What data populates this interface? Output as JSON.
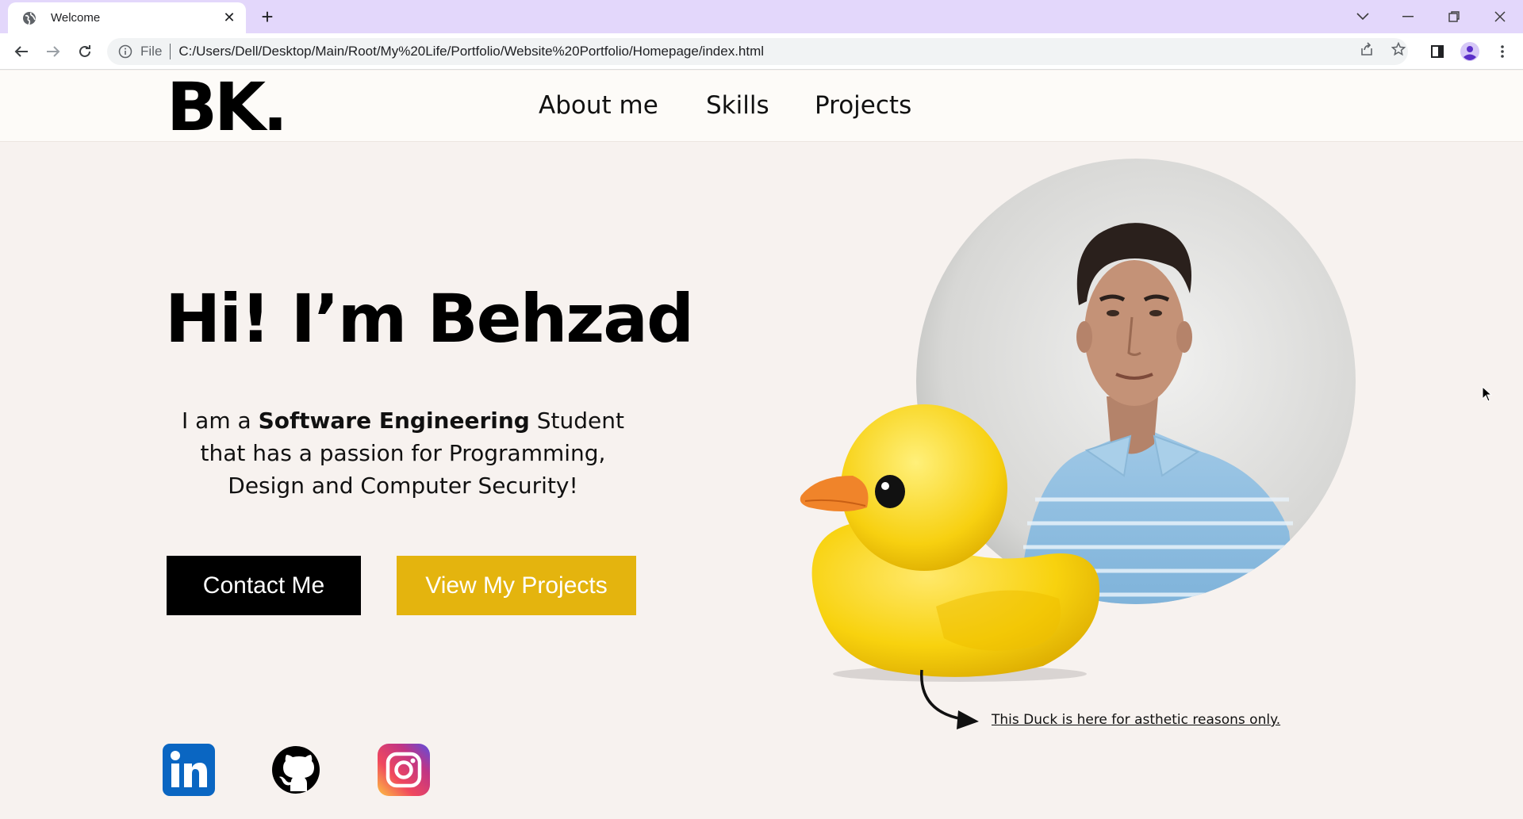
{
  "browser": {
    "tab_title": "Welcome",
    "omnibox_scheme": "File",
    "url": "C:/Users/Dell/Desktop/Main/Root/My%20Life/Portfolio/Website%20Portfolio/Homepage/index.html",
    "chrome_color": "#e3d7fb"
  },
  "site": {
    "logo": "BK.",
    "nav": [
      "About me",
      "Skills",
      "Projects"
    ]
  },
  "hero": {
    "title": "Hi! I’m Behzad",
    "intro_prefix": "I am a ",
    "intro_bold": "Software Engineering",
    "intro_suffix": " Student that has a passion for Programming, Design and Computer Security!",
    "contact_button": "Contact Me",
    "projects_button": "View My Projects",
    "accent_color": "#e4b40e"
  },
  "social": {
    "items": [
      "linkedin-icon",
      "github-icon",
      "instagram-icon"
    ]
  },
  "duck_caption": "This Duck is here for asthetic reasons only."
}
